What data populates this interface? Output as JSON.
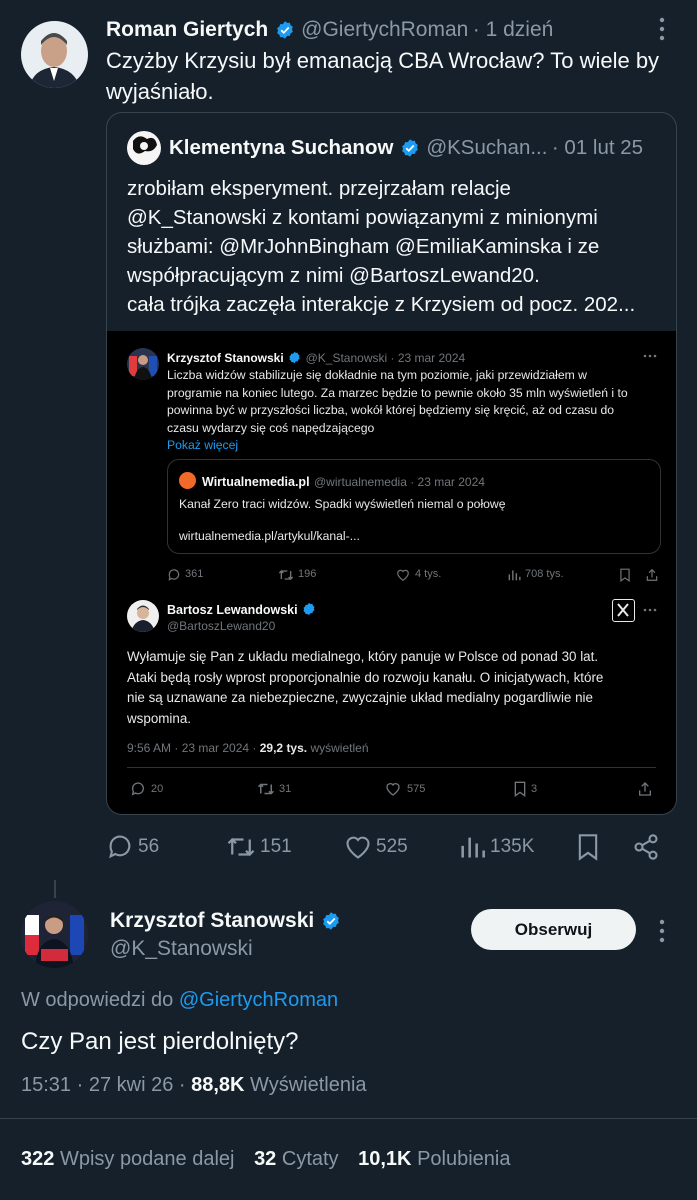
{
  "top_tweet": {
    "name": "Roman Giertych",
    "handle": "@GiertychRoman",
    "time": "· 1 dzień",
    "text_line1": "Czyżby Krzysiu był emanacją CBA Wrocław? To wiele by",
    "text_line2": "wyjaśniało."
  },
  "quote": {
    "name": "Klementyna Suchanow",
    "handle": "@KSuchan...",
    "time": "· 01 lut 25",
    "lines": [
      "zrobiłam eksperyment. przejrzałam relacje",
      "@K_Stanowski z kontami powiązanymi z minionymi",
      "służbami: @MrJohnBingham @EmiliaKaminska i ze",
      "współpracującym z nimi @BartoszLewand20.",
      "cała trójka zaczęła interakcje z Krzysiem od pocz. 202..."
    ]
  },
  "screenshot": {
    "post1": {
      "name": "Krzysztof Stanowski",
      "handle": "@K_Stanowski · 23 mar 2024",
      "lines": [
        "Liczba widzów stabilizuje się dokładnie na tym poziomie, jaki przewidziałem w",
        "programie na koniec lutego. Za marzec będzie to pewnie około 35 mln wyświetleń i to",
        "powinna być w przyszłości liczba, wokół której będziemy się kręcić, aż od czasu do",
        "czasu wydarzy się coś napędzającego"
      ],
      "show_more": "Pokaż więcej",
      "card": {
        "name": "Wirtualnemedia.pl",
        "handle": "@wirtualnemedia · 23 mar 2024",
        "text": "Kanał Zero traci widzów. Spadki wyświetleń niemal o połowę",
        "link": "wirtualnemedia.pl/artykul/kanal-..."
      },
      "actions": {
        "replies": "361",
        "reposts": "196",
        "likes": "4 tys.",
        "views": "708 tys."
      }
    },
    "post2": {
      "name": "Bartosz Lewandowski",
      "handle": "@BartoszLewand20",
      "lines": [
        "Wyłamuje się Pan z układu medialnego, który panuje w Polsce od ponad 30 lat.",
        "Ataki będą rosły wprost proporcjonalnie do rozwoju kanału. O inicjatywach, które",
        "nie są uznawane za niebezpieczne, zwyczajnie układ medialny pogardliwie nie",
        "wspomina."
      ],
      "meta_time": "9:56 AM · 23 mar 2024 ·",
      "meta_views": "29,2 tys.",
      "meta_views_label": "wyświetleń",
      "actions": {
        "replies": "20",
        "reposts": "31",
        "likes": "575",
        "bookmarks": "3"
      }
    }
  },
  "top_actions": {
    "replies": "56",
    "reposts": "151",
    "likes": "525",
    "views": "135K"
  },
  "reply": {
    "name": "Krzysztof Stanowski",
    "handle": "@K_Stanowski",
    "follow_label": "Obserwuj",
    "replying_prefix": "W odpowiedzi do",
    "replying_handle": "@GiertychRoman",
    "text": "Czy Pan jest pierdolnięty?",
    "time": "15:31 · 27 kwi 26 ·",
    "views_count": "88,8K",
    "views_label": "Wyświetlenia",
    "stats": {
      "reposts_count": "322",
      "reposts_label": "Wpisy podane dalej",
      "quotes_count": "32",
      "quotes_label": "Cytaty",
      "likes_count": "10,1K",
      "likes_label": "Polubienia"
    }
  },
  "colors": {
    "background": "#15202b",
    "accent": "#1d9bf0",
    "muted": "#8b98a5"
  }
}
